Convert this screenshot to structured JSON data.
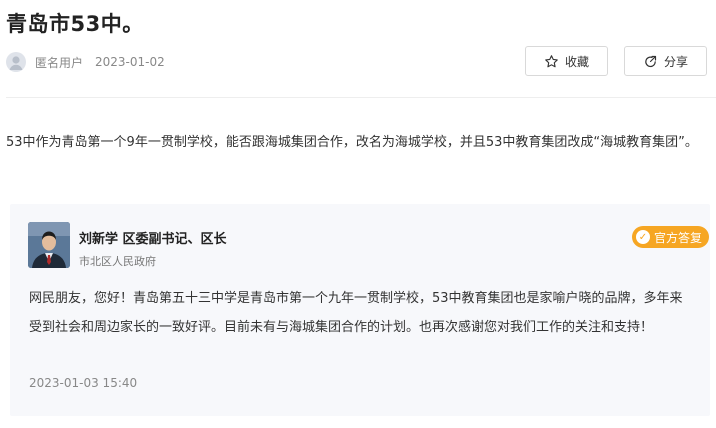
{
  "post": {
    "title": "青岛市53中。",
    "author": "匿名用户",
    "date": "2023-01-02",
    "question": "53中作为青岛第一个9年一贯制学校，能否跟海城集团合作，改名为海城学校，并且53中教育集团改成“海城教育集团”。"
  },
  "actions": {
    "favorite_label": "收藏",
    "share_label": "分享"
  },
  "reply": {
    "responder_name": "刘新学   区委副书记、区长",
    "responder_org": "市北区人民政府",
    "badge_label": "官方答复",
    "content": "网民朋友，您好！青岛第五十三中学是青岛市第一个九年一贯制学校，53中教育集团也是家喻户晓的品牌，多年来受到社会和周边家长的一致好评。目前未有与海城集团合作的计划。也再次感谢您对我们工作的关注和支持！",
    "time": "2023-01-03 15:40"
  },
  "icons": {
    "favorite": "star-icon",
    "share": "share-icon",
    "badge": "checkmark-icon"
  },
  "colors": {
    "badge": "#f6a623",
    "reply_background": "#f7f8fb"
  }
}
